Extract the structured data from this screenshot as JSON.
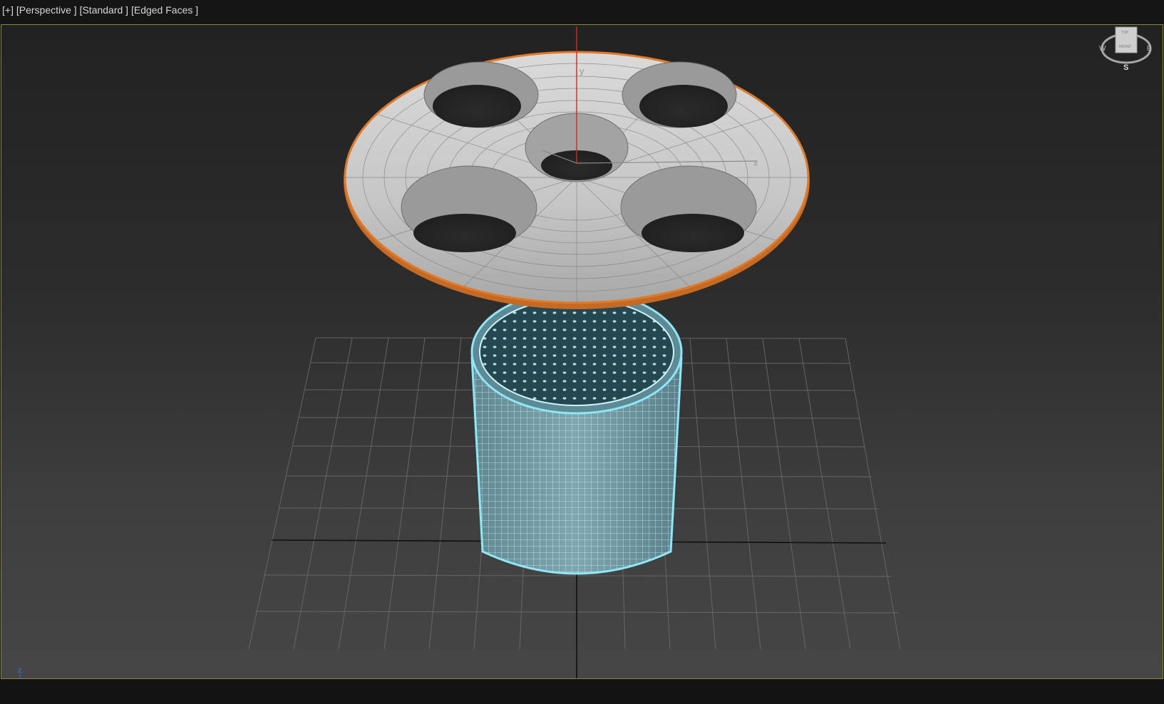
{
  "viewport": {
    "plus_label": "[+]",
    "view_label": "[Perspective ]",
    "shading_label": "[Standard ]",
    "display_label": "[Edged Faces ]"
  },
  "viewcube": {
    "top": "TOP",
    "front": "FRONT",
    "west": "W",
    "east": "E",
    "south": "S"
  },
  "gizmo": {
    "x": "x",
    "y": "y"
  },
  "axis_tripod": {
    "z": "z",
    "x": "x"
  },
  "colors": {
    "selection_orange": "#e07a2a",
    "cylinder_cyan": "#8fe6f5",
    "viewport_border": "#8c8a3a",
    "axis_red": "#c0302a"
  }
}
